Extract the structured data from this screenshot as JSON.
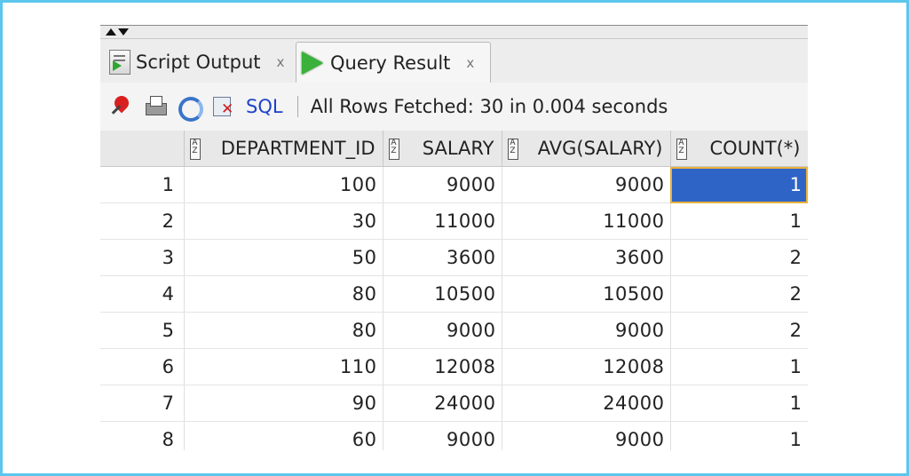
{
  "tabs": [
    {
      "label": "Script Output",
      "close": "x",
      "icon": "script-output-icon",
      "active": false
    },
    {
      "label": "Query Result",
      "close": "x",
      "icon": "play-icon",
      "active": true
    }
  ],
  "toolbar": {
    "icons": [
      "pin-icon",
      "print-icon",
      "refresh-icon",
      "delete-icon"
    ],
    "sql_label": "SQL",
    "status": "All Rows Fetched: 30 in 0.004 seconds"
  },
  "table": {
    "columns": [
      "DEPARTMENT_ID",
      "SALARY",
      "AVG(SALARY)",
      "COUNT(*)"
    ],
    "rows": [
      {
        "n": "1",
        "cells": [
          "100",
          "9000",
          "9000",
          "1"
        ]
      },
      {
        "n": "2",
        "cells": [
          "30",
          "11000",
          "11000",
          "1"
        ]
      },
      {
        "n": "3",
        "cells": [
          "50",
          "3600",
          "3600",
          "2"
        ]
      },
      {
        "n": "4",
        "cells": [
          "80",
          "10500",
          "10500",
          "2"
        ]
      },
      {
        "n": "5",
        "cells": [
          "80",
          "9000",
          "9000",
          "2"
        ]
      },
      {
        "n": "6",
        "cells": [
          "110",
          "12008",
          "12008",
          "1"
        ]
      },
      {
        "n": "7",
        "cells": [
          "90",
          "24000",
          "24000",
          "1"
        ]
      },
      {
        "n": "8",
        "cells": [
          "60",
          "9000",
          "9000",
          "1"
        ]
      }
    ],
    "selected_cell": {
      "row": 0,
      "col": 3
    }
  },
  "colors": {
    "frame": "#5cc6ec",
    "selection": "#2f64c7",
    "link": "#1f43c8"
  }
}
